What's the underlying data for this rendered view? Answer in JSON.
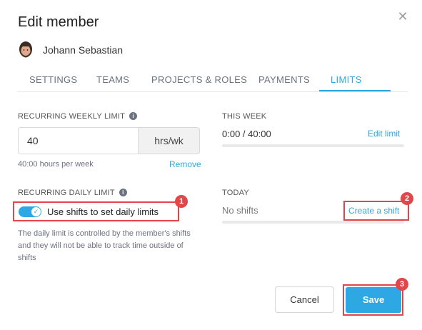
{
  "dialog": {
    "title": "Edit member",
    "close_icon": "close-icon",
    "member_name": "Johann Sebastian"
  },
  "tabs": [
    {
      "label": "SETTINGS",
      "active": false
    },
    {
      "label": "TEAMS",
      "active": false
    },
    {
      "label": "PROJECTS & ROLES",
      "active": false
    },
    {
      "label": "PAYMENTS",
      "active": false
    },
    {
      "label": "LIMITS",
      "active": true
    }
  ],
  "weekly": {
    "label": "RECURRING WEEKLY LIMIT",
    "value": "40",
    "unit": "hrs/wk",
    "helper": "40:00 hours per week",
    "remove_label": "Remove"
  },
  "this_week": {
    "label": "THIS WEEK",
    "value": "0:00 / 40:00",
    "link": "Edit limit",
    "progress": 0
  },
  "daily": {
    "label": "RECURRING DAILY LIMIT",
    "toggle_on": true,
    "toggle_label": "Use shifts to set daily limits",
    "description": "The daily limit is controlled by the member's shifts and they will not be able to track time outside of shifts"
  },
  "today": {
    "label": "TODAY",
    "value": "No shifts",
    "link": "Create a shift",
    "progress": 0
  },
  "buttons": {
    "cancel": "Cancel",
    "save": "Save"
  },
  "annotations": [
    "1",
    "2",
    "3"
  ],
  "colors": {
    "accent": "#2ea8e5",
    "highlight": "#e2454a"
  }
}
